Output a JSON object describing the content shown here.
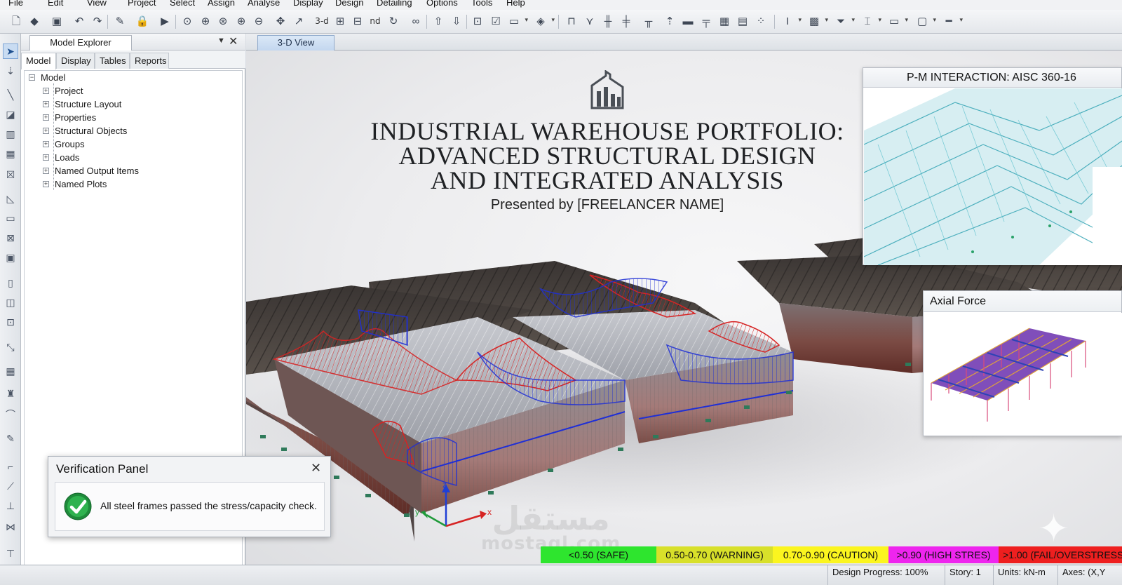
{
  "menu": [
    "File",
    "Edit",
    "View",
    "Project",
    "Select",
    "Assign",
    "Analyse",
    "Display",
    "Design",
    "Detailing",
    "Options",
    "Tools",
    "Help"
  ],
  "toolbar": {
    "view_3d_label": "3-d",
    "view_nd_label": "nd",
    "icons": [
      "new-file",
      "open",
      "save",
      "undo",
      "redo",
      "edit",
      "lock",
      "run",
      "zoom-window",
      "zoom-in",
      "zoom-previous",
      "zoom-in-step",
      "zoom-out-step",
      "pan",
      "rubber-band",
      "3d-view",
      "plan-view",
      "elevation-view",
      "rotate",
      "perspective",
      "move-up",
      "move-down",
      "select-objects",
      "check",
      "display-options",
      "shading",
      "draw-frame",
      "draw-brace",
      "draw-beams",
      "quick-draw",
      "draw-column",
      "draw-wall",
      "draw-floor",
      "draw-area",
      "draw-link",
      "text-style",
      "set-display",
      "filter",
      "section",
      "grid",
      "extrude",
      "line-style"
    ]
  },
  "explorer": {
    "title": "Model Explorer",
    "tabs": [
      "Model",
      "Display",
      "Tables",
      "Reports"
    ],
    "active_tab": "Model",
    "root": "Model",
    "nodes": [
      "Project",
      "Structure Layout",
      "Properties",
      "Structural Objects",
      "Groups",
      "Loads",
      "Named Output Items",
      "Named Plots"
    ]
  },
  "view": {
    "tab": "3-D View",
    "title_lines": [
      "INDUSTRIAL WAREHOUSE PORTFOLIO:",
      "ADVANCED STRUCTURAL DESIGN",
      "AND INTEGRATED ANALYSIS"
    ],
    "subtitle": "Presented by [FREELANCER NAME]"
  },
  "pm_panel": {
    "title": "P-M INTERACTION: AISC 360-16"
  },
  "axial_panel": {
    "title": "Axial Force"
  },
  "verification": {
    "title": "Verification Panel",
    "message": "All steel frames passed the stress/capacity check."
  },
  "triad": {
    "x": "x",
    "y": "y",
    "z": "z"
  },
  "legend": [
    {
      "label": "<0.50 (SAFE)",
      "color": "#2ee52e"
    },
    {
      "label": "0.50-0.70 (WARNING)",
      "color": "#d8e02a"
    },
    {
      "label": "0.70-0.90 (CAUTION)",
      "color": "#fbf51f"
    },
    {
      "label": ">0.90 (HIGH STRES)",
      "color": "#ee25ee"
    },
    {
      "label": ">1.00 (FAIL/OVERSTRESS)",
      "color": "#ee1f1f"
    }
  ],
  "status": {
    "progress": "Design Progress: 100%",
    "story": "Story: 1",
    "units": "Units: kN-m",
    "axes": "Axes: (X,Y"
  },
  "watermark": {
    "arabic": "مستقل",
    "latin": "mostaql.com"
  },
  "colors": {
    "accent": "#1f5fae",
    "tension": "#d62424",
    "compression": "#1f2fd6"
  }
}
